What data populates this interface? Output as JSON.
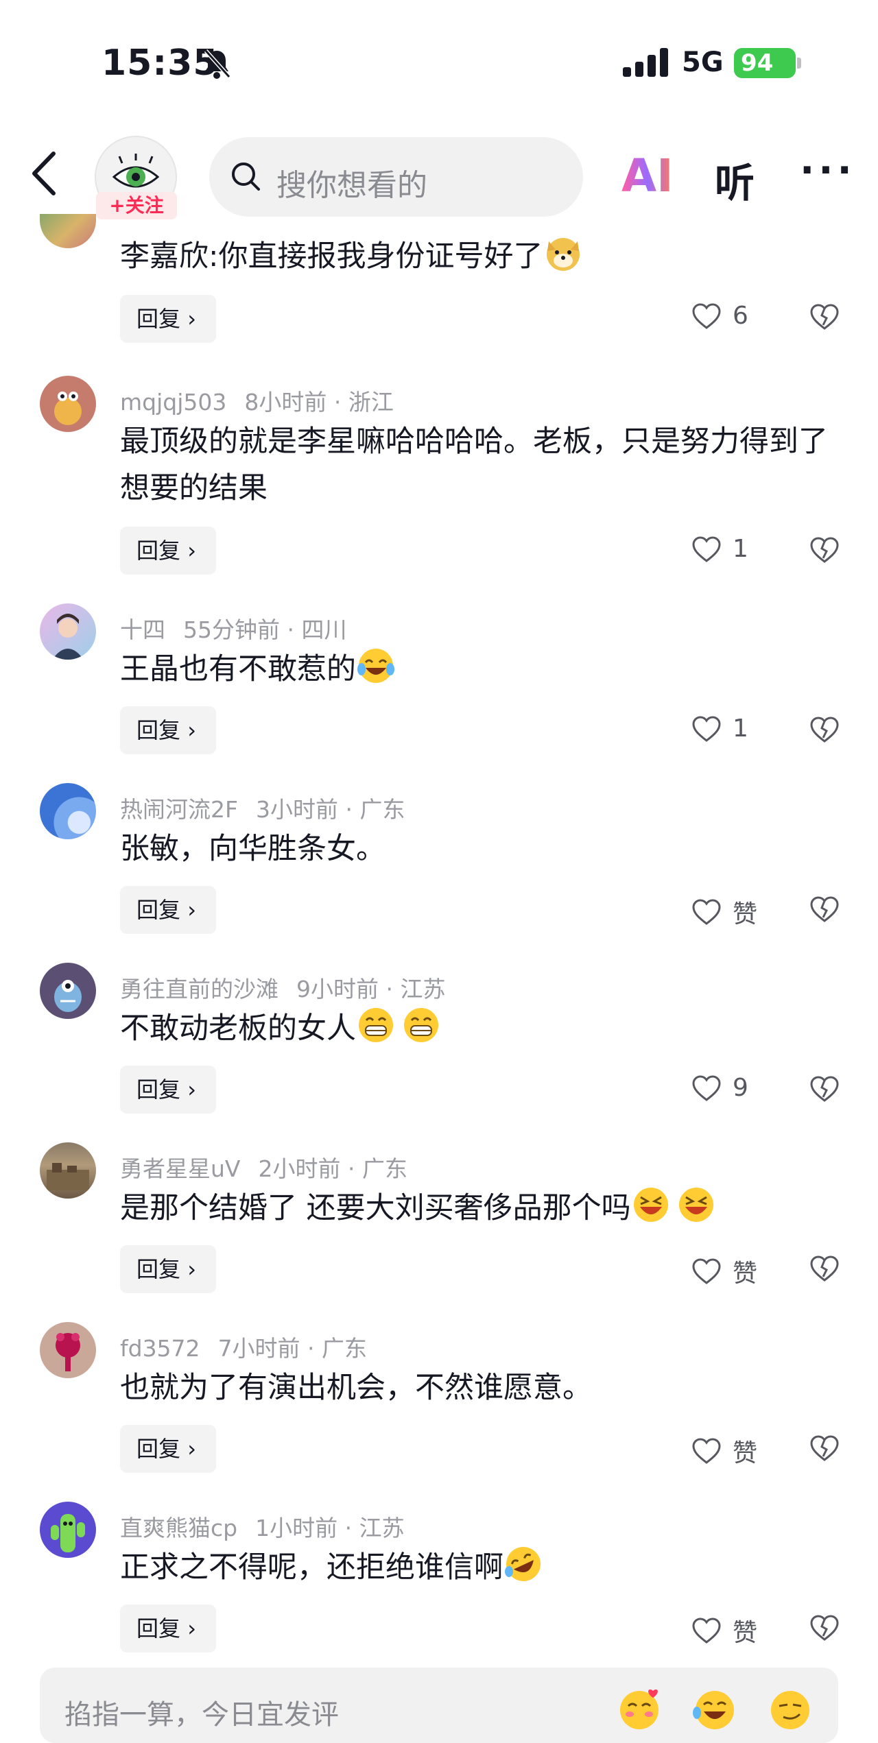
{
  "status_bar": {
    "time": "15:35",
    "network": "5G",
    "battery": "94"
  },
  "top_nav": {
    "follow_label": "+关注",
    "search_placeholder": "搜你想看的",
    "ai_label": "AI",
    "listen_label": "听",
    "more_label": "···"
  },
  "comments": [
    {
      "user": "",
      "time": "",
      "location": "",
      "text": "李嘉欣:你直接报我身份证号好了",
      "emoji": "dog-emoji",
      "reply_label": "回复",
      "likes": "6"
    },
    {
      "user": "mqjqj503",
      "time": "8小时前",
      "location": "浙江",
      "text": "最顶级的就是李星嘛哈哈哈哈。老板，只是努力得到了想要的结果",
      "reply_label": "回复",
      "likes": "1"
    },
    {
      "user": "十四",
      "time": "55分钟前",
      "location": "四川",
      "text": "王晶也有不敢惹的",
      "emoji": "laughing-tears-emoji",
      "reply_label": "回复",
      "likes": "1"
    },
    {
      "user": "热闹河流2F",
      "time": "3小时前",
      "location": "广东",
      "text": "张敏，向华胜条女。",
      "reply_label": "回复",
      "likes": "赞"
    },
    {
      "user": "勇往直前的沙滩",
      "time": "9小时前",
      "location": "江苏",
      "text": "不敢动老板的女人",
      "emoji": "grin-emoji",
      "reply_label": "回复",
      "likes": "9"
    },
    {
      "user": "勇者星星uV",
      "time": "2小时前",
      "location": "广东",
      "text": "是那个结婚了 还要大刘买奢侈品那个吗",
      "emoji": "squint-laugh-emoji",
      "reply_label": "回复",
      "likes": "赞"
    },
    {
      "user": "fd3572",
      "time": "7小时前",
      "location": "广东",
      "text": "也就为了有演出机会，不然谁愿意。",
      "reply_label": "回复",
      "likes": "赞"
    },
    {
      "user": "直爽熊猫cp",
      "time": "1小时前",
      "location": "江苏",
      "text": "正求之不得呢，还拒绝谁信啊",
      "emoji": "rolling-laugh-emoji",
      "reply_label": "回复",
      "likes": "赞"
    }
  ],
  "bottom_input": {
    "placeholder": "掐指一算，今日宜发评"
  },
  "colors": {
    "accent_red": "#fe2c55",
    "meta_gray": "#9a9ba1",
    "battery_green": "#3ec94f"
  }
}
